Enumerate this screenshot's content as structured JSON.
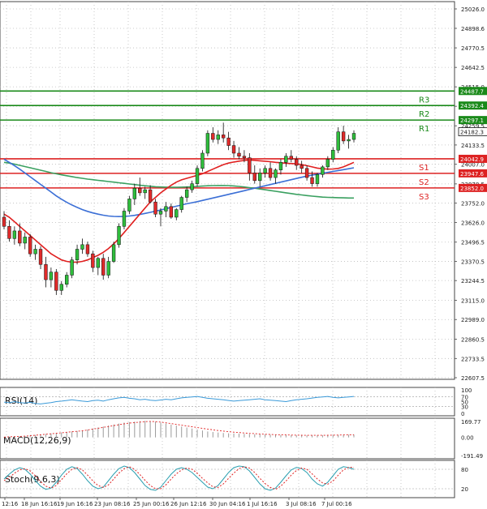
{
  "chart_data": [
    {
      "type": "candlestick",
      "ylim": [
        22607.5,
        25026.0
      ],
      "y_ticks": [
        25026.0,
        24898.6,
        24770.5,
        24642.5,
        24515.0,
        24387.5,
        24259.5,
        24133.5,
        24007.0,
        23878.5,
        23752.0,
        23626.0,
        23496.5,
        23370.5,
        23244.5,
        23115.0,
        22989.0,
        22860.5,
        22733.5,
        22607.5
      ],
      "y_tick_labels": [
        "25026.0",
        "24898.6",
        "24770.5",
        "24642.5",
        "24515.0",
        "24387.5",
        "24259.5",
        "24133.5",
        "24007.0",
        "23878.5",
        "23752.0",
        "23626.0",
        "23496.5",
        "23370.5",
        "23244.5",
        "23115.0",
        "22989.0",
        "22860.5",
        "22733.5",
        "22607.5"
      ],
      "x_labels": [
        "12:16",
        "18 Jun 16:16",
        "19 Jun 16:16",
        "23 Jun 08:16",
        "25 Jun 00:16",
        "26 Jun 12:16",
        "30 Jun 04:16",
        "1 Jul 16:16",
        "3 Jul 08:16",
        "7 Jul 00:16"
      ],
      "current_price": "24182.3",
      "levels": [
        {
          "name": "R3",
          "value": 24487.7,
          "label": "24487.7",
          "color": "#1a8a1a"
        },
        {
          "name": "R2",
          "value": 24392.4,
          "label": "24392.4",
          "color": "#1a8a1a"
        },
        {
          "name": "R1",
          "value": 24297.1,
          "label": "24297.1",
          "color": "#1a8a1a"
        },
        {
          "name": "S1",
          "value": 24042.9,
          "label": "24042.9",
          "color": "#dd2222"
        },
        {
          "name": "S2",
          "value": 23947.6,
          "label": "23947.6",
          "color": "#dd2222"
        },
        {
          "name": "S3",
          "value": 23852.0,
          "label": "23852.0",
          "color": "#dd2222"
        }
      ],
      "candles": [
        [
          23660,
          23700,
          23580,
          23600
        ],
        [
          23600,
          23640,
          23500,
          23520
        ],
        [
          23520,
          23600,
          23480,
          23570
        ],
        [
          23570,
          23620,
          23470,
          23490
        ],
        [
          23490,
          23560,
          23450,
          23530
        ],
        [
          23530,
          23550,
          23400,
          23420
        ],
        [
          23420,
          23480,
          23380,
          23450
        ],
        [
          23450,
          23470,
          23320,
          23350
        ],
        [
          23350,
          23400,
          23200,
          23250
        ],
        [
          23250,
          23330,
          23200,
          23300
        ],
        [
          23300,
          23320,
          23150,
          23180
        ],
        [
          23180,
          23240,
          23150,
          23220
        ],
        [
          23220,
          23300,
          23200,
          23280
        ],
        [
          23280,
          23400,
          23260,
          23380
        ],
        [
          23380,
          23480,
          23350,
          23450
        ],
        [
          23450,
          23520,
          23420,
          23480
        ],
        [
          23480,
          23500,
          23400,
          23420
        ],
        [
          23420,
          23440,
          23300,
          23330
        ],
        [
          23330,
          23400,
          23280,
          23390
        ],
        [
          23390,
          23420,
          23250,
          23280
        ],
        [
          23280,
          23400,
          23260,
          23370
        ],
        [
          23370,
          23500,
          23360,
          23480
        ],
        [
          23480,
          23620,
          23460,
          23600
        ],
        [
          23600,
          23720,
          23580,
          23700
        ],
        [
          23700,
          23800,
          23680,
          23780
        ],
        [
          23780,
          23880,
          23740,
          23850
        ],
        [
          23850,
          23920,
          23800,
          23820
        ],
        [
          23820,
          23860,
          23780,
          23840
        ],
        [
          23840,
          23870,
          23750,
          23760
        ],
        [
          23760,
          23780,
          23660,
          23680
        ],
        [
          23680,
          23720,
          23600,
          23700
        ],
        [
          23700,
          23760,
          23660,
          23730
        ],
        [
          23730,
          23750,
          23650,
          23660
        ],
        [
          23660,
          23720,
          23640,
          23710
        ],
        [
          23710,
          23800,
          23690,
          23790
        ],
        [
          23790,
          23860,
          23760,
          23840
        ],
        [
          23840,
          23900,
          23820,
          23880
        ],
        [
          23880,
          24000,
          23860,
          23980
        ],
        [
          23980,
          24100,
          23960,
          24080
        ],
        [
          24080,
          24230,
          24060,
          24210
        ],
        [
          24210,
          24250,
          24150,
          24170
        ],
        [
          24170,
          24230,
          24140,
          24200
        ],
        [
          24200,
          24280,
          24150,
          24180
        ],
        [
          24180,
          24220,
          24100,
          24130
        ],
        [
          24130,
          24160,
          24050,
          24080
        ],
        [
          24080,
          24120,
          24040,
          24060
        ],
        [
          24060,
          24100,
          24020,
          24050
        ],
        [
          24050,
          24080,
          23900,
          23950
        ],
        [
          23950,
          24000,
          23880,
          23900
        ],
        [
          23900,
          23980,
          23860,
          23950
        ],
        [
          23950,
          24000,
          23920,
          23980
        ],
        [
          23980,
          24020,
          23900,
          23920
        ],
        [
          23920,
          23980,
          23880,
          23970
        ],
        [
          23970,
          24040,
          23940,
          24020
        ],
        [
          24020,
          24080,
          23990,
          24060
        ],
        [
          24060,
          24100,
          24020,
          24040
        ],
        [
          24040,
          24060,
          23970,
          24000
        ],
        [
          24000,
          24030,
          23950,
          23980
        ],
        [
          23980,
          24000,
          23900,
          23920
        ],
        [
          23920,
          23960,
          23860,
          23880
        ],
        [
          23880,
          23950,
          23860,
          23940
        ],
        [
          23940,
          24000,
          23920,
          23990
        ],
        [
          23990,
          24060,
          23970,
          24040
        ],
        [
          24040,
          24120,
          24020,
          24100
        ],
        [
          24100,
          24250,
          24080,
          24220
        ],
        [
          24220,
          24260,
          24140,
          24160
        ],
        [
          24160,
          24200,
          24110,
          24170
        ],
        [
          24170,
          24230,
          24150,
          24210
        ]
      ],
      "sma_red": [
        23680,
        23660,
        23630,
        23600,
        23570,
        23540,
        23510,
        23480,
        23450,
        23420,
        23400,
        23380,
        23370,
        23365,
        23365,
        23370,
        23380,
        23395,
        23410,
        23430,
        23455,
        23485,
        23520,
        23560,
        23600,
        23640,
        23680,
        23720,
        23760,
        23790,
        23820,
        23845,
        23870,
        23890,
        23905,
        23915,
        23925,
        23935,
        23945,
        23960,
        23975,
        23990,
        24005,
        24015,
        24022,
        24028,
        24032,
        24035,
        24033,
        24030,
        24027,
        24024,
        24020,
        24017,
        24014,
        24012,
        24010,
        24005,
        23998,
        23990,
        23982,
        23978,
        23975,
        23976,
        23980,
        23990,
        24005,
        24020
      ],
      "sma_blue": [
        24040,
        24020,
        23998,
        23975,
        23950,
        23925,
        23900,
        23875,
        23850,
        23825,
        23800,
        23778,
        23758,
        23740,
        23724,
        23710,
        23698,
        23688,
        23680,
        23673,
        23668,
        23665,
        23664,
        23665,
        23668,
        23672,
        23678,
        23685,
        23692,
        23700,
        23708,
        23716,
        23724,
        23732,
        23740,
        23748,
        23755,
        23762,
        23770,
        23778,
        23786,
        23794,
        23802,
        23810,
        23818,
        23826,
        23834,
        23842,
        23850,
        23858,
        23866,
        23874,
        23882,
        23890,
        23898,
        23906,
        23914,
        23922,
        23930,
        23936,
        23942,
        23948,
        23954,
        23960,
        23966,
        23972,
        23978,
        23984
      ],
      "sma_green": [
        24020,
        24015,
        24008,
        24000,
        23992,
        23984,
        23976,
        23968,
        23960,
        23952,
        23945,
        23938,
        23932,
        23926,
        23920,
        23915,
        23910,
        23906,
        23902,
        23898,
        23894,
        23890,
        23886,
        23882,
        23878,
        23874,
        23870,
        23866,
        23863,
        23860,
        23858,
        23857,
        23856,
        23856,
        23857,
        23858,
        23860,
        23862,
        23864,
        23866,
        23867,
        23868,
        23868,
        23867,
        23865,
        23862,
        23858,
        23854,
        23850,
        23845,
        23840,
        23835,
        23830,
        23825,
        23820,
        23815,
        23810,
        23806,
        23802,
        23798,
        23795,
        23792,
        23790,
        23789,
        23788,
        23787,
        23786,
        23786
      ]
    },
    {
      "type": "line",
      "title": "RSI(14)",
      "y_tick_labels": [
        "100",
        "70",
        "50",
        "30",
        "0"
      ],
      "series": [
        {
          "values": [
            48,
            45,
            50,
            46,
            44,
            47,
            42,
            40,
            43,
            46,
            50,
            52,
            55,
            58,
            55,
            52,
            50,
            54,
            56,
            52,
            58,
            62,
            66,
            68,
            64,
            62,
            58,
            60,
            56,
            54,
            57,
            60,
            58,
            62,
            66,
            68,
            70,
            72,
            68,
            64,
            62,
            60,
            58,
            55,
            52,
            54,
            56,
            58,
            60,
            62,
            58,
            56,
            54,
            52,
            50,
            54,
            58,
            60,
            62,
            65,
            68,
            70,
            72,
            68,
            66,
            68,
            70,
            72
          ]
        }
      ]
    },
    {
      "type": "bar",
      "title": "MACD(12,26,9)",
      "y_tick_labels": [
        "169.77",
        "0.00",
        "-191.49"
      ],
      "series": [
        {
          "values": [
            5,
            8,
            10,
            12,
            15,
            20,
            25,
            30,
            35,
            40,
            45,
            50,
            55,
            60,
            65,
            70,
            80,
            90,
            100,
            110,
            120,
            130,
            140,
            150,
            155,
            160,
            165,
            168,
            165,
            160,
            150,
            140,
            130,
            120,
            110,
            100,
            90,
            80,
            70,
            60,
            55,
            50,
            45,
            42,
            40,
            38,
            36,
            34,
            32,
            30,
            28,
            26,
            25,
            24,
            23,
            22,
            21,
            20,
            20,
            20,
            21,
            22,
            23,
            24,
            25,
            26,
            27,
            28
          ]
        },
        {
          "values": [
            3,
            6,
            8,
            10,
            13,
            17,
            22,
            27,
            32,
            37,
            42,
            47,
            52,
            57,
            62,
            67,
            75,
            84,
            93,
            102,
            111,
            120,
            129,
            138,
            145,
            150,
            155,
            160,
            162,
            160,
            155,
            148,
            140,
            132,
            124,
            116,
            108,
            100,
            92,
            84,
            77,
            70,
            64,
            58,
            53,
            49,
            45,
            41,
            38,
            35,
            32,
            30,
            28,
            26,
            25,
            24,
            23,
            22,
            21,
            21,
            21,
            21,
            22,
            23,
            24,
            25,
            26,
            27
          ]
        }
      ]
    },
    {
      "type": "line",
      "title": "Stoch(9,6,3)",
      "y_tick_labels": [
        "80",
        "20"
      ],
      "series": [
        {
          "values": [
            50,
            65,
            78,
            85,
            80,
            65,
            45,
            28,
            18,
            22,
            40,
            62,
            80,
            88,
            82,
            65,
            45,
            28,
            20,
            25,
            45,
            65,
            82,
            90,
            85,
            70,
            50,
            30,
            18,
            15,
            25,
            45,
            65,
            80,
            85,
            80,
            70,
            55,
            40,
            25,
            20,
            30,
            50,
            70,
            85,
            90,
            88,
            75,
            55,
            35,
            20,
            15,
            22,
            40,
            60,
            78,
            86,
            82,
            70,
            50,
            35,
            28,
            40,
            60,
            80,
            88,
            85,
            80
          ]
        },
        {
          "values": [
            45,
            55,
            68,
            78,
            82,
            75,
            60,
            42,
            28,
            22,
            30,
            48,
            66,
            80,
            85,
            78,
            62,
            44,
            30,
            24,
            32,
            50,
            68,
            82,
            88,
            80,
            64,
            46,
            30,
            20,
            20,
            32,
            50,
            66,
            78,
            84,
            80,
            68,
            52,
            38,
            26,
            24,
            35,
            52,
            68,
            82,
            88,
            84,
            70,
            52,
            36,
            24,
            18,
            28,
            44,
            62,
            76,
            84,
            80,
            66,
            50,
            38,
            34,
            44,
            62,
            78,
            86,
            86
          ]
        }
      ]
    }
  ]
}
